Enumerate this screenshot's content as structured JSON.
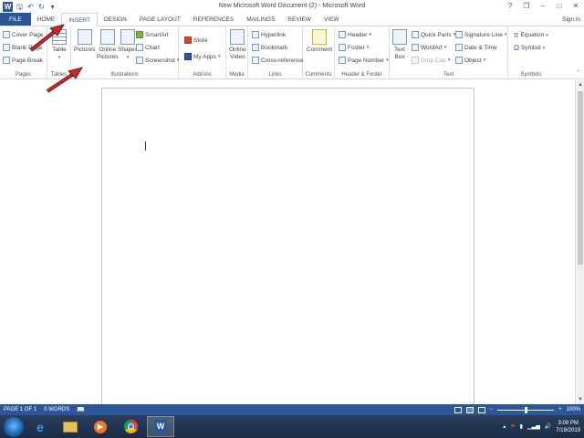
{
  "window": {
    "title": "New Microsoft Word Document (2) - Microsoft Word",
    "app_icon": "W",
    "controls": [
      "?",
      "❒",
      "–",
      "□",
      "✕"
    ]
  },
  "tabs": {
    "file": "FILE",
    "items": [
      "HOME",
      "INSERT",
      "DESIGN",
      "PAGE LAYOUT",
      "REFERENCES",
      "MAILINGS",
      "REVIEW",
      "VIEW"
    ],
    "active": "INSERT",
    "signin": "Sign in"
  },
  "ribbon": {
    "pages": {
      "label": "Pages",
      "cover_page": "Cover Page",
      "blank_page": "Blank Page",
      "page_break": "Page Break"
    },
    "tables": {
      "label": "Tables",
      "table": "Table"
    },
    "illustrations": {
      "label": "Illustrations",
      "pictures": "Pictures",
      "online_pictures_1": "Online",
      "online_pictures_2": "Pictures",
      "shapes": "Shapes",
      "smartart": "SmartArt",
      "chart": "Chart",
      "screenshot": "Screenshot"
    },
    "addins": {
      "label": "Add-ins",
      "store": "Store",
      "my_apps": "My Apps"
    },
    "media": {
      "label": "Media",
      "online_video_1": "Online",
      "online_video_2": "Video"
    },
    "links": {
      "label": "Links",
      "hyperlink": "Hyperlink",
      "bookmark": "Bookmark",
      "cross_reference": "Cross-reference"
    },
    "comments": {
      "label": "Comments",
      "comment": "Comment"
    },
    "header_footer": {
      "label": "Header & Footer",
      "header": "Header",
      "footer": "Footer",
      "page_number": "Page Number"
    },
    "text": {
      "label": "Text",
      "text_box_1": "Text",
      "text_box_2": "Box",
      "quick_parts": "Quick Parts",
      "wordart": "WordArt",
      "drop_cap": "Drop Cap",
      "signature_line": "Signature Line",
      "date_time": "Date & Time",
      "object": "Object"
    },
    "symbols": {
      "label": "Symbols",
      "equation": "Equation",
      "symbol": "Symbol"
    }
  },
  "status": {
    "page": "PAGE 1 OF 1",
    "words": "0 WORDS",
    "zoom": "100%",
    "zoom_level": 0.5
  },
  "taskbar": {
    "time": "3:09 PM",
    "date": "7/19/2019"
  }
}
